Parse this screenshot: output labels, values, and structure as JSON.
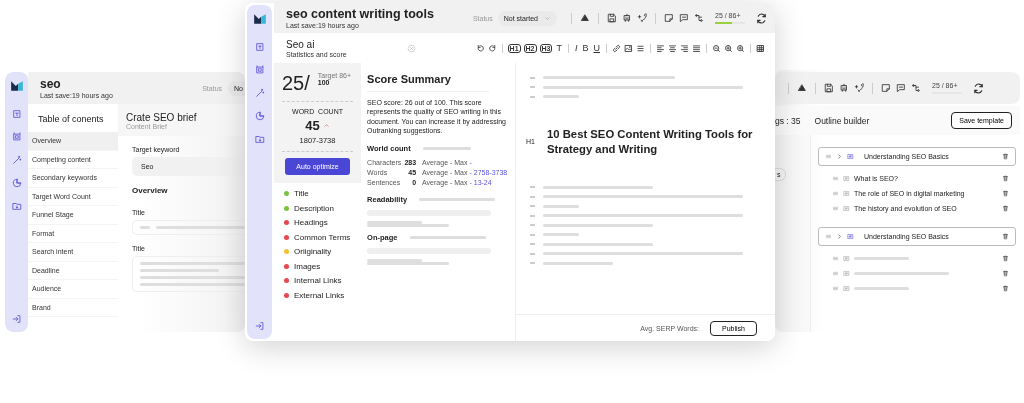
{
  "left_window": {
    "title": "seo",
    "last_save": "Last save:19 hours ago",
    "status_label": "Status",
    "status_value": "No",
    "toc": {
      "title": "Table of conents",
      "items": [
        {
          "label": "Overview",
          "selected": true
        },
        {
          "label": "Competing content",
          "selected": false
        },
        {
          "label": "Secondary keywords",
          "selected": false
        },
        {
          "label": "Target Word Count",
          "selected": false
        },
        {
          "label": "Funnel Stage",
          "selected": false
        },
        {
          "label": "Format",
          "selected": false
        },
        {
          "label": "Search intent",
          "selected": false
        },
        {
          "label": "Deadline",
          "selected": false
        },
        {
          "label": "Audience",
          "selected": false
        },
        {
          "label": "Brand",
          "selected": false
        }
      ]
    },
    "brief": {
      "title": "Crate SEO brief",
      "subtitle": "Content Brief",
      "keyword_label": "Target keyword",
      "keyword_value": "Seo",
      "section": "Overview",
      "fields": [
        {
          "label": "Title",
          "kind": "line"
        },
        {
          "label": "Title",
          "kind": "area"
        }
      ]
    }
  },
  "main_window": {
    "title": "seo content writing tools",
    "last_save": "Last save:19 hours ago",
    "status_label": "Status",
    "status_value": "Not started",
    "progress": {
      "label": "25 / 86+",
      "level": 0.55
    },
    "panel": {
      "title": "Seo ai",
      "subtitle": "Statistics and score"
    },
    "heading_buttons": [
      "H1",
      "H2",
      "H3",
      "T"
    ],
    "format_buttons": [
      "I",
      "B",
      "U"
    ],
    "score": {
      "value": "25/",
      "target": "Target 86+",
      "max": "100",
      "word_count_label": "WORD  COUNT",
      "word_count": "45",
      "word_range": "1807-3738",
      "button": "Auto optimize"
    },
    "checks": [
      {
        "label": "Title",
        "color": "#7cc242"
      },
      {
        "label": "Description",
        "color": "#7cc242"
      },
      {
        "label": "Headings",
        "color": "#e5484d"
      },
      {
        "label": "Common Terms",
        "color": "#e5484d"
      },
      {
        "label": "Oriiginality",
        "color": "#f2c037"
      },
      {
        "label": "Images",
        "color": "#e5484d"
      },
      {
        "label": "Internal Links",
        "color": "#e5484d"
      },
      {
        "label": "External Links",
        "color": "#e5484d"
      }
    ],
    "summary": {
      "title": "Score Summary",
      "text": "SEO score: 26 out of 100. This score represents the quality of SEO writing in this document. You can increase it by addressing Outranking suggestions.",
      "world_count": "World count",
      "stats": [
        {
          "name": "Characters",
          "value": "283",
          "compare": "Average - Max",
          "range": "-"
        },
        {
          "name": "Words",
          "value": "45",
          "compare": "Average - Max",
          "range": "- 2758-3738"
        },
        {
          "name": "Sentences",
          "value": "0",
          "compare": "Average - Max",
          "range": "- 13-24"
        }
      ],
      "readability": "Readability",
      "on_page": "On-page"
    },
    "editor": {
      "heading_tag": "H1",
      "heading": "10 Best SEO Content Writing Tools for Strategy and Writing",
      "serp_label": "Avg. SERP Words:",
      "publish": "Publish"
    }
  },
  "right_window": {
    "progress": {
      "label": "25 / 86+"
    },
    "count_text": "gs : 35",
    "chip": "s",
    "title": "Outline builder",
    "save": "Save template",
    "outline": [
      {
        "title": "Understanding SEO Basics",
        "children": [
          {
            "kind": "text",
            "title": "What is SEO?"
          },
          {
            "kind": "text",
            "title": "The role of SEO in digital marketing"
          },
          {
            "kind": "text",
            "title": "The history and evolution of SEO"
          }
        ]
      },
      {
        "title": "Understanding SEO Basics",
        "children": [
          {
            "kind": "placeholder"
          },
          {
            "kind": "placeholder"
          },
          {
            "kind": "placeholder"
          }
        ]
      }
    ]
  }
}
